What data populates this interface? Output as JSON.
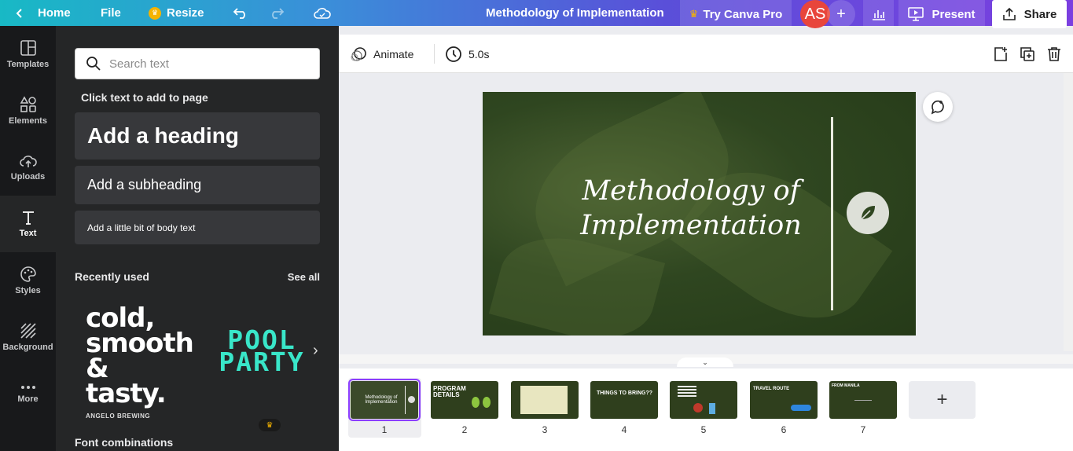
{
  "topbar": {
    "home_label": "Home",
    "file_label": "File",
    "resize_label": "Resize",
    "doc_title": "Methodology of Implementation",
    "try_pro_label": "Try Canva Pro",
    "avatar_initials": "AS",
    "present_label": "Present",
    "share_label": "Share"
  },
  "rail": {
    "items": [
      {
        "label": "Templates",
        "icon": "templates-icon"
      },
      {
        "label": "Elements",
        "icon": "elements-icon"
      },
      {
        "label": "Uploads",
        "icon": "uploads-icon"
      },
      {
        "label": "Text",
        "icon": "text-icon"
      },
      {
        "label": "Styles",
        "icon": "styles-icon"
      },
      {
        "label": "Background",
        "icon": "background-icon"
      },
      {
        "label": "More",
        "icon": "more-icon"
      }
    ]
  },
  "panel": {
    "search_placeholder": "Search text",
    "click_text": "Click text to add to page",
    "add_heading": "Add a heading",
    "add_subheading": "Add a subheading",
    "add_body": "Add a little bit of body text",
    "recently_used": "Recently used",
    "see_all": "See all",
    "font_tile1_lines": [
      "cold,",
      "smooth",
      "& tasty."
    ],
    "font_tile1_sub": "ANGELO BREWING",
    "font_tile2_lines": [
      "POOL",
      "PARTY"
    ],
    "font_combinations": "Font combinations"
  },
  "toolbar": {
    "animate_label": "Animate",
    "duration_label": "5.0s"
  },
  "slide": {
    "title_line1": "Methodology of",
    "title_line2": "Implementation"
  },
  "filmstrip": {
    "pages": [
      {
        "num": "1",
        "text": "Methodology of Implementation"
      },
      {
        "num": "2",
        "text": "PROGRAM DETAILS"
      },
      {
        "num": "3",
        "text": ""
      },
      {
        "num": "4",
        "text": "THINGS TO BRING??"
      },
      {
        "num": "5",
        "text": ""
      },
      {
        "num": "6",
        "text": "TRAVEL ROUTE"
      },
      {
        "num": "7",
        "text": "FROM MANILA"
      }
    ],
    "add_page": "+"
  },
  "colors": {
    "accent": "#8b3dff",
    "slide_bg": "#2f4620",
    "panel_bg": "#252627",
    "rail_bg": "#18191b"
  }
}
